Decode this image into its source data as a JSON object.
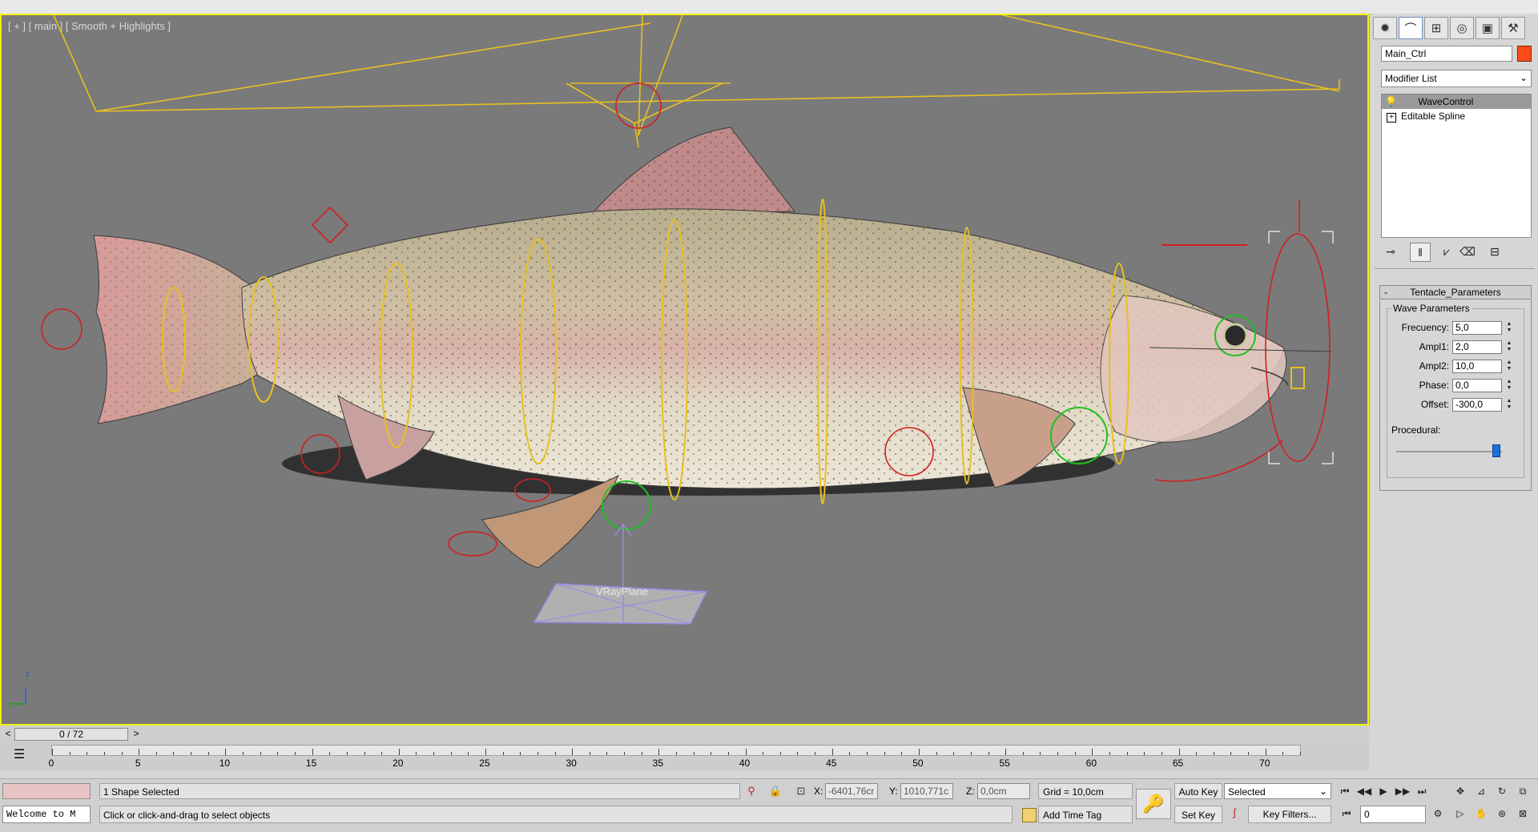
{
  "viewport": {
    "label": "[ + ] [ main ] [ Smooth + Highlights ]",
    "helper_label": "VRayPlane",
    "axis_label": "z",
    "colors": {
      "background": "#7a7a7a",
      "border": "#f2f20a",
      "helpers": "#e8c020",
      "controls": "#d02020",
      "gizmo": "#20c020"
    }
  },
  "command_panel": {
    "tabs": [
      "create-icon",
      "modify-icon",
      "hierarchy-icon",
      "motion-icon",
      "display-icon",
      "utilities-icon"
    ],
    "object_name": "Main_Ctrl",
    "object_color": "#ff4a1a",
    "modifier_list": "Modifier List",
    "stack": [
      {
        "label": "WaveControl",
        "selected": true
      },
      {
        "label": "Editable Spline",
        "selected": false
      }
    ],
    "rollout_title": "Tentacle_Parameters",
    "group_title": "Wave Parameters",
    "params": [
      {
        "label": "Frecuency:",
        "value": "5,0"
      },
      {
        "label": "Ampl1:",
        "value": "2,0"
      },
      {
        "label": "Ampl2:",
        "value": "10,0"
      },
      {
        "label": "Phase:",
        "value": "0,0"
      },
      {
        "label": "Offset:",
        "value": "-300,0"
      }
    ],
    "procedural_label": "Procedural:",
    "procedural_slider_value": 0.95
  },
  "timeline": {
    "frame_display": "0 / 72",
    "prev": "<",
    "next": ">",
    "ticks": [
      "0",
      "5",
      "10",
      "15",
      "20",
      "25",
      "30",
      "35",
      "40",
      "45",
      "50",
      "55",
      "60",
      "65",
      "70"
    ]
  },
  "status": {
    "maxscript_text": "Welcome to M",
    "selection": "1 Shape Selected",
    "prompt": "Click or click-and-drag to select objects",
    "x_label": "X:",
    "x_value": "-6401,76cr",
    "y_label": "Y:",
    "y_value": "1010,771c",
    "z_label": "Z:",
    "z_value": "0,0cm",
    "grid": "Grid = 10,0cm",
    "time_tag": "Add Time Tag",
    "auto_key": "Auto Key",
    "set_key": "Set Key",
    "selection_set": "Selected",
    "key_filters": "Key Filters...",
    "current_frame": "0"
  }
}
